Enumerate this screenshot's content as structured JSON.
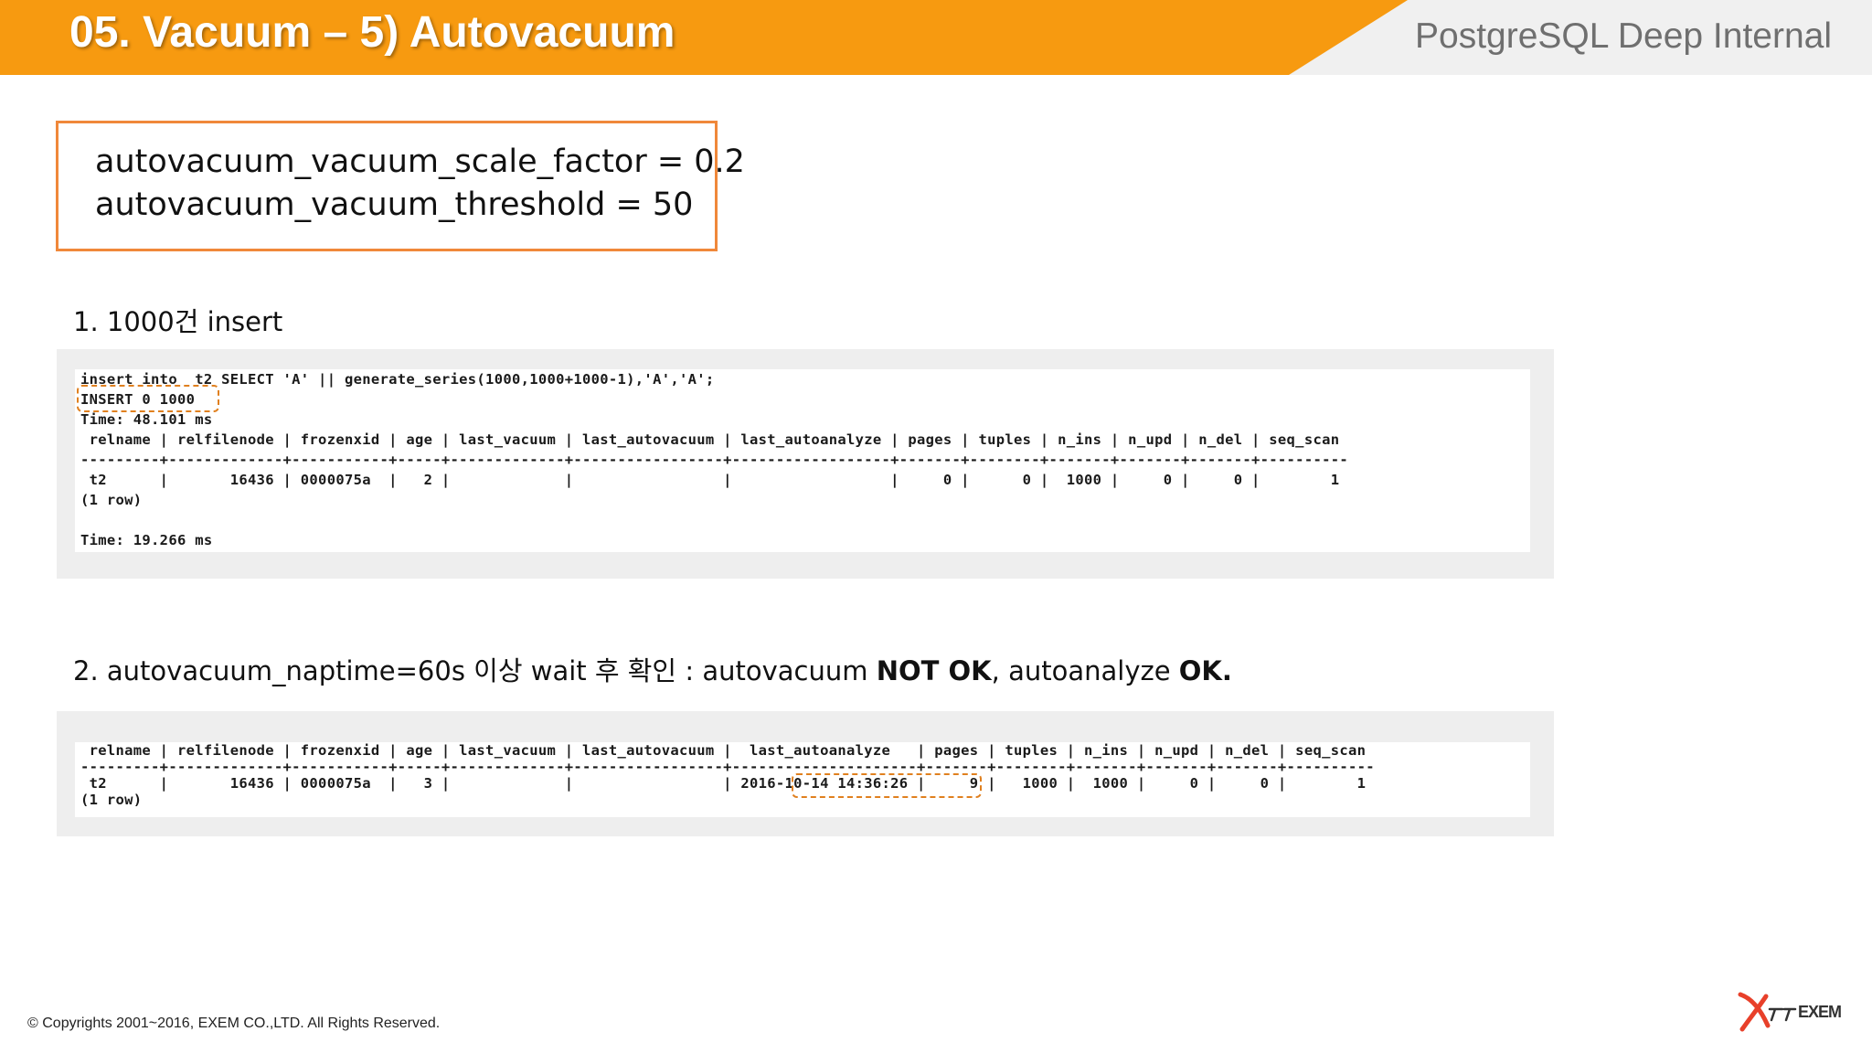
{
  "header": {
    "title": "05. Vacuum – 5) Autovacuum",
    "subtitle": "PostgreSQL Deep Internal"
  },
  "config": {
    "line1": "autovacuum_vacuum_scale_factor = 0.2",
    "line2": "autovacuum_vacuum_threshold = 50"
  },
  "step1": {
    "heading": "1. 1000건 insert",
    "lines": [
      "insert into  t2 SELECT 'A' || generate_series(1000,1000+1000-1),'A','A';",
      "INSERT 0 1000",
      "Time: 48.101 ms",
      " relname | relfilenode | frozenxid | age | last_vacuum | last_autovacuum | last_autoanalyze | pages | tuples | n_ins | n_upd | n_del | seq_scan",
      "---------+-------------+-----------+-----+-------------+-----------------+------------------+-------+--------+-------+-------+-------+----------",
      " t2      |       16436 | 0000075a  |   2 |             |                 |                  |     0 |      0 |  1000 |     0 |     0 |        1",
      "(1 row)",
      "",
      "Time: 19.266 ms"
    ]
  },
  "step2": {
    "heading_prefix": "2. autovacuum_naptime=60s 이상 wait 후 확인 : autovacuum ",
    "heading_bold1": "NOT OK",
    "heading_mid": ", autoanalyze  ",
    "heading_bold2": "OK.",
    "lines": [
      " relname | relfilenode | frozenxid | age | last_vacuum | last_autovacuum |  last_autoanalyze   | pages | tuples | n_ins | n_upd | n_del | seq_scan",
      "---------+-------------+-----------+-----+-------------+-----------------+---------------------+-------+--------+-------+-------+-------+----------",
      " t2      |       16436 | 0000075a  |   3 |             |                 | 2016-10-14 14:36:26 |     9 |   1000 |  1000 |     0 |     0 |        1",
      "(1 row)"
    ]
  },
  "footer": {
    "copyright": "© Copyrights 2001~2016, EXEM CO.,LTD. All Rights Reserved.",
    "logo_text": "EXEM"
  },
  "colors": {
    "header_orange": "#f79a10",
    "accent_border": "#f0883a",
    "dashed_highlight": "#e0801f"
  }
}
